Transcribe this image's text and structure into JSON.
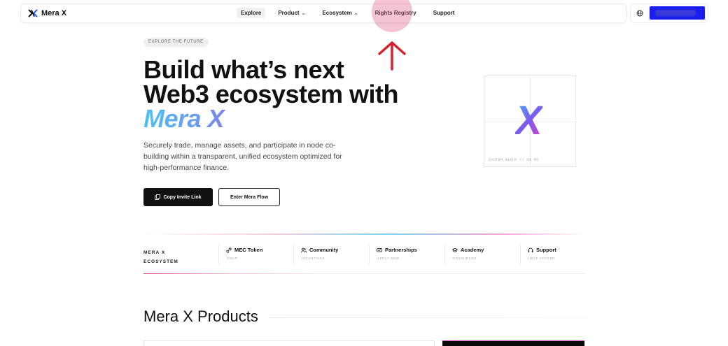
{
  "nav": {
    "brand": "Mera X",
    "items": [
      {
        "label": "Explore",
        "active": true,
        "dropdown": false
      },
      {
        "label": "Product",
        "active": false,
        "dropdown": true
      },
      {
        "label": "Ecosystem",
        "active": false,
        "dropdown": true
      },
      {
        "label": "Rights Registry",
        "active": false,
        "dropdown": false
      },
      {
        "label": "Support",
        "active": false,
        "dropdown": false
      }
    ]
  },
  "hero": {
    "eyebrow": "EXPLORE THE FUTURE",
    "title_line1": "Build what’s next",
    "title_line2": "Web3 ecosystem with",
    "title_brand": "Mera X",
    "subtitle": "Securely trade, manage assets, and participate in node co-building within a transparent, unified ecosystem optimized for high-performance finance.",
    "primary_button": "Copy Invite Link",
    "secondary_button": "Enter Mera Flow"
  },
  "card": {
    "logo_glyph": "X",
    "status": "SYSTEM_READY // 00 MS"
  },
  "ecosystem": {
    "label_line1": "MERA X",
    "label_line2": "ECOSYSTEM",
    "items": [
      {
        "title": "MEC Token",
        "sub": "SWAP",
        "icon": "link-icon"
      },
      {
        "title": "Community",
        "sub": "INCENTIVES",
        "icon": "users-icon"
      },
      {
        "title": "Partnerships",
        "sub": "APPLY NOW",
        "icon": "handshake-icon"
      },
      {
        "title": "Academy",
        "sub": "RESOURCES",
        "icon": "graduation-cap-icon"
      },
      {
        "title": "Support",
        "sub": "HELP CENTER",
        "icon": "headset-icon"
      }
    ]
  },
  "products": {
    "title": "Mera X Products"
  },
  "colors": {
    "accent_blue": "#1a1df0",
    "annotation": "#d63a78",
    "arrow": "#d4212b"
  }
}
